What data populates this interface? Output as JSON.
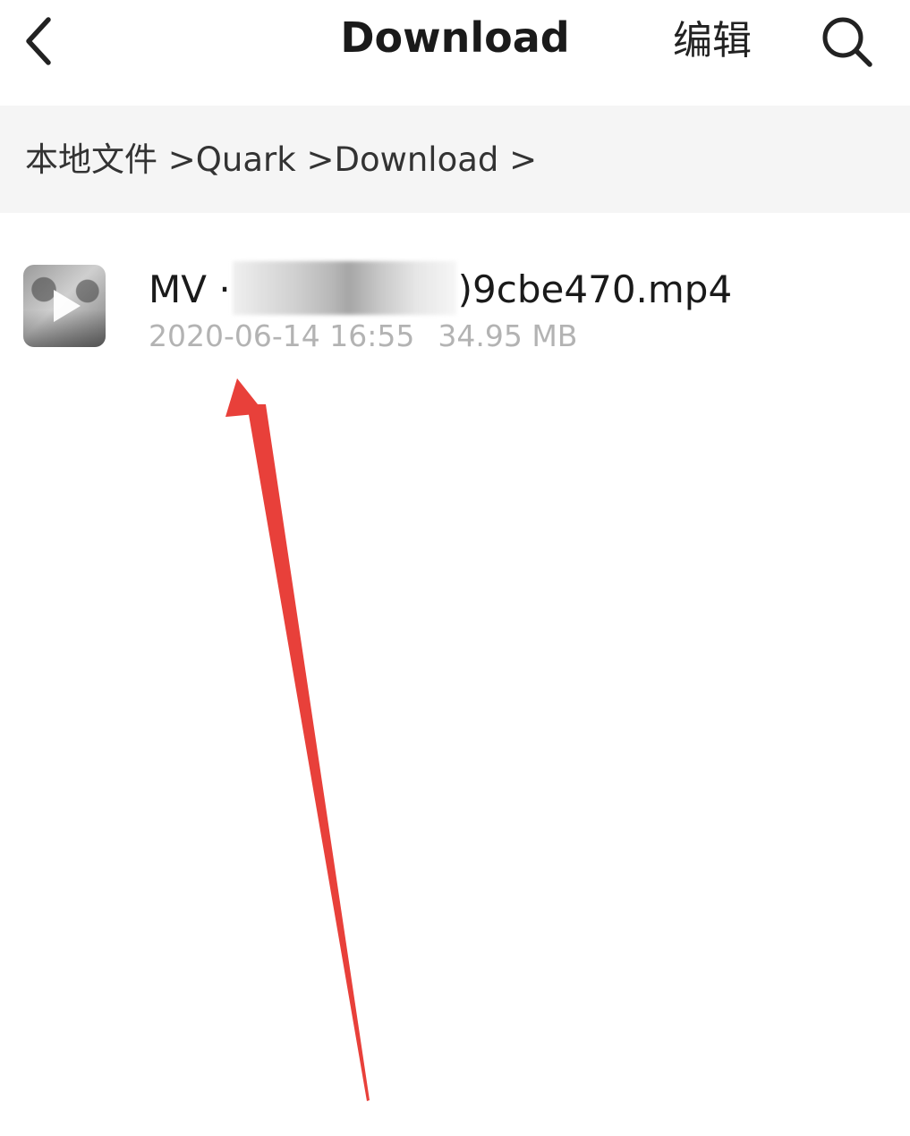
{
  "header": {
    "title": "Download",
    "edit_label": "编辑",
    "back_icon": "chevron-left-icon",
    "search_icon": "search-icon"
  },
  "breadcrumb": {
    "items": [
      "本地文件",
      "Quark",
      "Download"
    ],
    "separator": ">"
  },
  "files": [
    {
      "name_prefix": "MV ·",
      "name_suffix": ")9cbe470.mp4",
      "date": "2020-06-14 16:55",
      "size": "34.95 MB",
      "thumbnail_icon": "video-thumbnail-icon"
    }
  ],
  "annotation": {
    "arrow_color": "#e8403a"
  },
  "colors": {
    "breadcrumb_bg": "#f5f5f5",
    "meta_text": "#b3b3b3"
  }
}
